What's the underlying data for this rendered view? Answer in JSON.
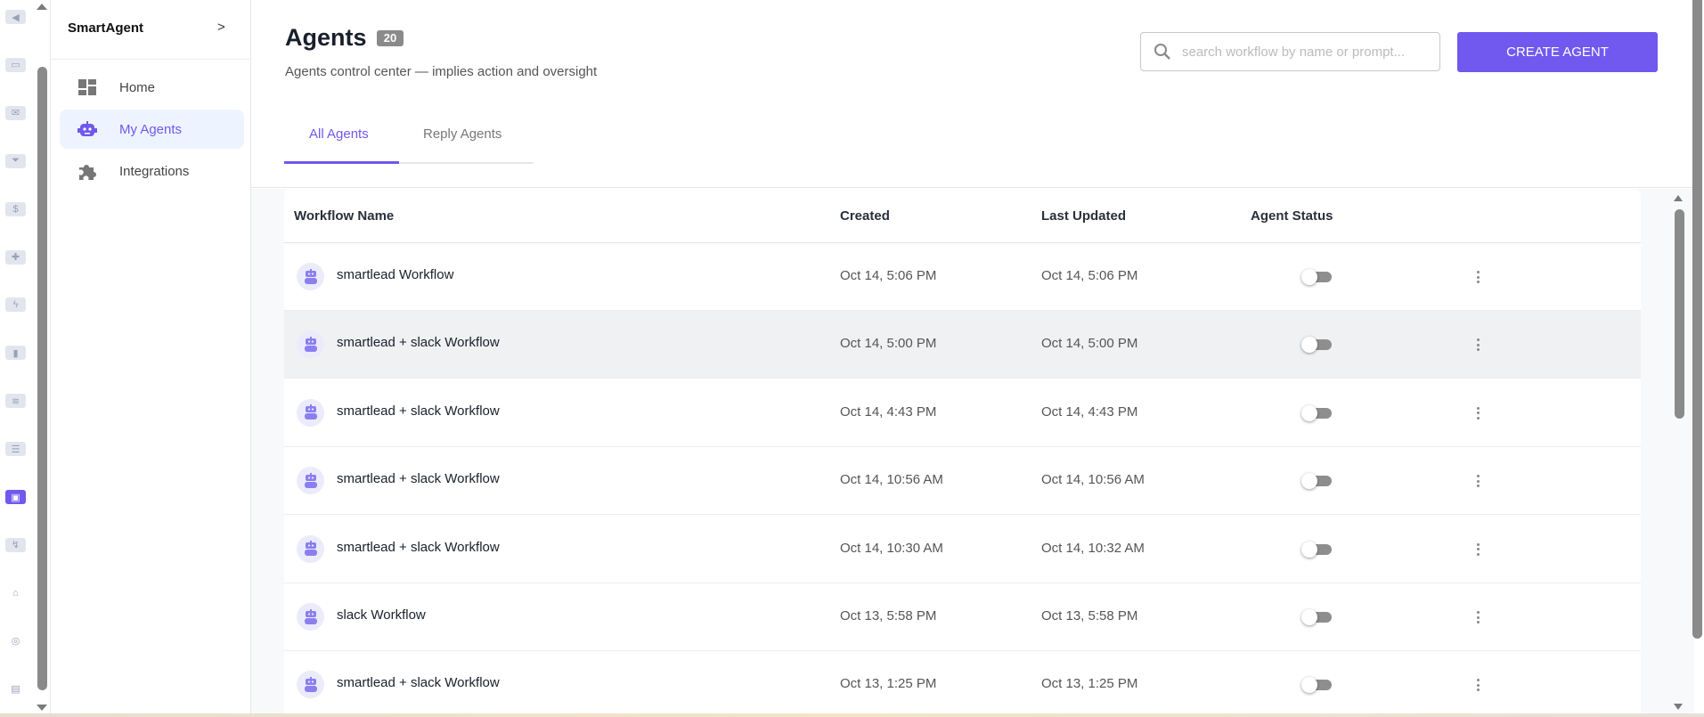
{
  "rail": {
    "icons": [
      "megaphone-icon",
      "inbox-icon",
      "mail-icon",
      "filter-icon",
      "dollar-icon",
      "puzzle-icon",
      "lightning-icon",
      "bar-chart-icon",
      "layers-icon",
      "server-icon",
      "robot-icon",
      "workflow-icon",
      "bank-icon",
      "support-icon",
      "book-icon"
    ],
    "active_index": 10
  },
  "sidebar": {
    "brand": "SmartAgent",
    "expand": ">",
    "items": [
      {
        "label": "Home",
        "icon": "dashboard-icon"
      },
      {
        "label": "My Agents",
        "icon": "robot-icon",
        "active": true
      },
      {
        "label": "Integrations",
        "icon": "puzzle-icon"
      }
    ]
  },
  "header": {
    "title": "Agents",
    "count": "20",
    "subtitle": "Agents control center — implies action and oversight",
    "search_placeholder": "search workflow by name or prompt...",
    "search_value": "",
    "create_label": "CREATE AGENT",
    "tabs": [
      {
        "label": "All Agents",
        "active": true
      },
      {
        "label": "Reply Agents",
        "active": false
      }
    ]
  },
  "colors": {
    "accent": "#7158ee",
    "active_bg": "#eef4ff"
  },
  "table": {
    "columns": [
      "Workflow Name",
      "Created",
      "Last Updated",
      "Agent Status"
    ],
    "rows": [
      {
        "name": "smartlead Workflow",
        "created": "Oct 14, 5:06 PM",
        "updated": "Oct 14, 5:06 PM",
        "status_on": false
      },
      {
        "name": "smartlead + slack Workflow",
        "created": "Oct 14, 5:00 PM",
        "updated": "Oct 14, 5:00 PM",
        "status_on": false
      },
      {
        "name": "smartlead + slack Workflow",
        "created": "Oct 14, 4:43 PM",
        "updated": "Oct 14, 4:43 PM",
        "status_on": false
      },
      {
        "name": "smartlead + slack Workflow",
        "created": "Oct 14, 10:56 AM",
        "updated": "Oct 14, 10:56 AM",
        "status_on": false
      },
      {
        "name": "smartlead + slack Workflow",
        "created": "Oct 14, 10:30 AM",
        "updated": "Oct 14, 10:32 AM",
        "status_on": false
      },
      {
        "name": "slack Workflow",
        "created": "Oct 13, 5:58 PM",
        "updated": "Oct 13, 5:58 PM",
        "status_on": false
      },
      {
        "name": "smartlead + slack Workflow",
        "created": "Oct 13, 1:25 PM",
        "updated": "Oct 13, 1:25 PM",
        "status_on": false
      }
    ]
  }
}
